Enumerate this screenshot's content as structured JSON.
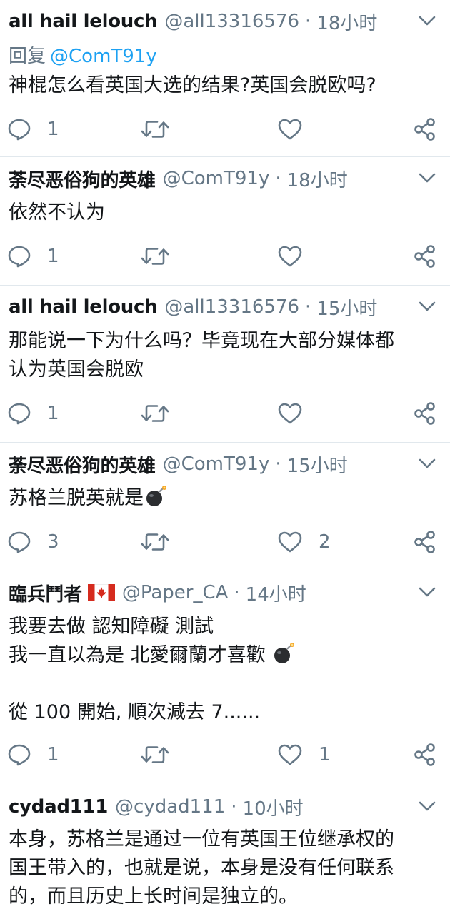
{
  "tweets": [
    {
      "name": "all hail lelouch",
      "handle": "@all13316576",
      "dot": "·",
      "time": "18小时",
      "reply_prefix": "回复",
      "reply_to": "@ComT91y",
      "lines": [
        "神棍怎么看英国大选的结果?英国会脱欧吗?"
      ],
      "reply_count": "1",
      "retweet_count": "",
      "like_count": ""
    },
    {
      "name": "荼尽恶俗狗的英雄",
      "handle": "@ComT91y",
      "dot": "·",
      "time": "18小时",
      "lines": [
        "依然不认为"
      ],
      "reply_count": "1",
      "retweet_count": "",
      "like_count": ""
    },
    {
      "name": "all hail lelouch",
      "handle": "@all13316576",
      "dot": "·",
      "time": "15小时",
      "lines": [
        "那能说一下为什么吗？毕竟现在大部分媒体都",
        "认为英国会脱欧"
      ],
      "reply_count": "1",
      "retweet_count": "",
      "like_count": ""
    },
    {
      "name": "荼尽恶俗狗的英雄",
      "handle": "@ComT91y",
      "dot": "·",
      "time": "15小时",
      "lines": [
        "苏格兰脱英就是"
      ],
      "reply_count": "3",
      "retweet_count": "",
      "like_count": "2"
    },
    {
      "name": "臨兵鬥者",
      "handle": "@Paper_CA",
      "dot": "·",
      "time": "14小时",
      "lines": [
        "我要去做 認知障礙 測試",
        "我一直以為是 北愛爾蘭才喜歡",
        "",
        "從 100 開始, 順次減去 7......"
      ],
      "reply_count": "1",
      "retweet_count": "",
      "like_count": "1"
    },
    {
      "name": "cydad111",
      "handle": "@cydad111",
      "dot": "·",
      "time": "10小时",
      "lines": [
        "本身，苏格兰是通过一位有英国王位继承权的",
        "国王带入的，也就是说，本身是没有任何联系",
        "的，而且历史上长时间是独立的。"
      ]
    }
  ],
  "icons": {
    "reply": "reply-icon",
    "retweet": "retweet-icon",
    "like": "heart-icon",
    "share": "share-icon",
    "more": "chevron-down-icon",
    "bomb": "bomb-emoji-icon",
    "flag": "canada-flag-icon"
  },
  "colors": {
    "text": "#14171a",
    "secondary": "#657786",
    "link": "#1da1f2",
    "divider": "#e1e8ed",
    "flag_red": "#d52b1e"
  }
}
